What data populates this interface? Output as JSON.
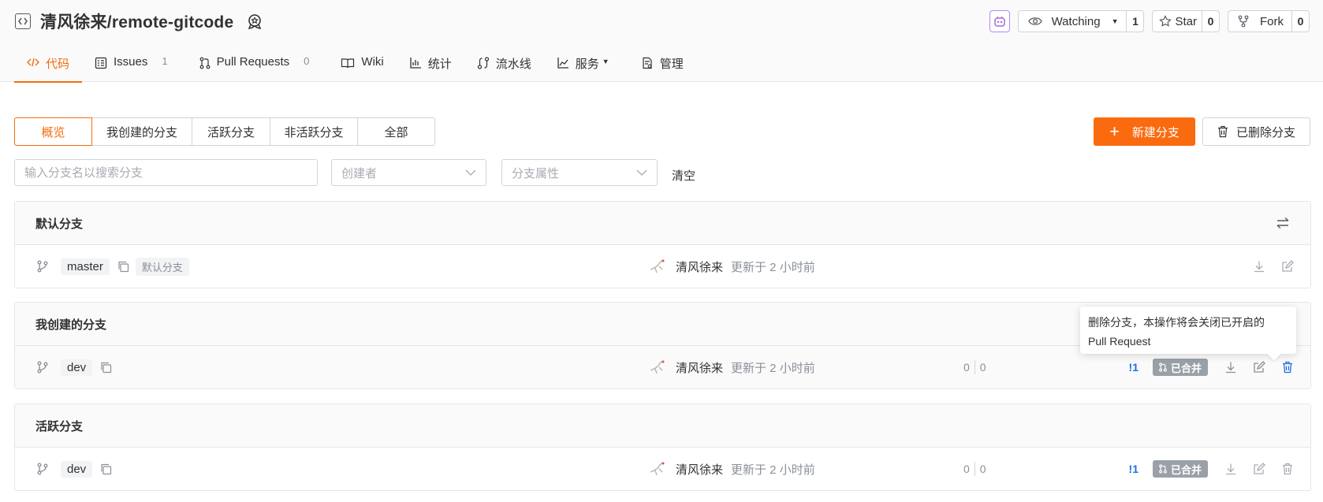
{
  "repo": {
    "title": "清风徐来/remote-gitcode"
  },
  "actions": {
    "watch_label": "Watching",
    "watch_count": "1",
    "star_label": "Star",
    "star_count": "0",
    "fork_label": "Fork",
    "fork_count": "0"
  },
  "tabs": [
    {
      "label": "代码",
      "count": ""
    },
    {
      "label": "Issues",
      "count": "1"
    },
    {
      "label": "Pull Requests",
      "count": "0"
    },
    {
      "label": "Wiki",
      "count": ""
    },
    {
      "label": "统计",
      "count": ""
    },
    {
      "label": "流水线",
      "count": ""
    },
    {
      "label": "服务",
      "count": ""
    },
    {
      "label": "管理",
      "count": ""
    }
  ],
  "filters": {
    "segments": [
      "概览",
      "我创建的分支",
      "活跃分支",
      "非活跃分支",
      "全部"
    ],
    "new_branch": "新建分支",
    "deleted_branches": "已删除分支",
    "search_placeholder": "输入分支名以搜索分支",
    "creator_placeholder": "创建者",
    "attribute_placeholder": "分支属性",
    "clear": "清空"
  },
  "sections": {
    "default": {
      "title": "默认分支",
      "row": {
        "name": "master",
        "tag": "默认分支",
        "author": "清风徐来",
        "updated": "更新于 2 小时前"
      }
    },
    "mine": {
      "title": "我创建的分支",
      "row": {
        "name": "dev",
        "author": "清风徐来",
        "updated": "更新于 2 小时前",
        "behind": "0",
        "ahead": "0",
        "pr_count": "!1",
        "status": "已合并"
      }
    },
    "active": {
      "title": "活跃分支",
      "row": {
        "name": "dev",
        "author": "清风徐来",
        "updated": "更新于 2 小时前",
        "behind": "0",
        "ahead": "0",
        "pr_count": "!1",
        "status": "已合并"
      }
    }
  },
  "tooltip": {
    "text_line1": "删除分支，本操作将会关闭已开启的",
    "text_line2": "Pull Request"
  },
  "colors": {
    "accent": "#fa6a0f",
    "link": "#1a6fe0",
    "merged_badge": "#9aa0a8"
  }
}
